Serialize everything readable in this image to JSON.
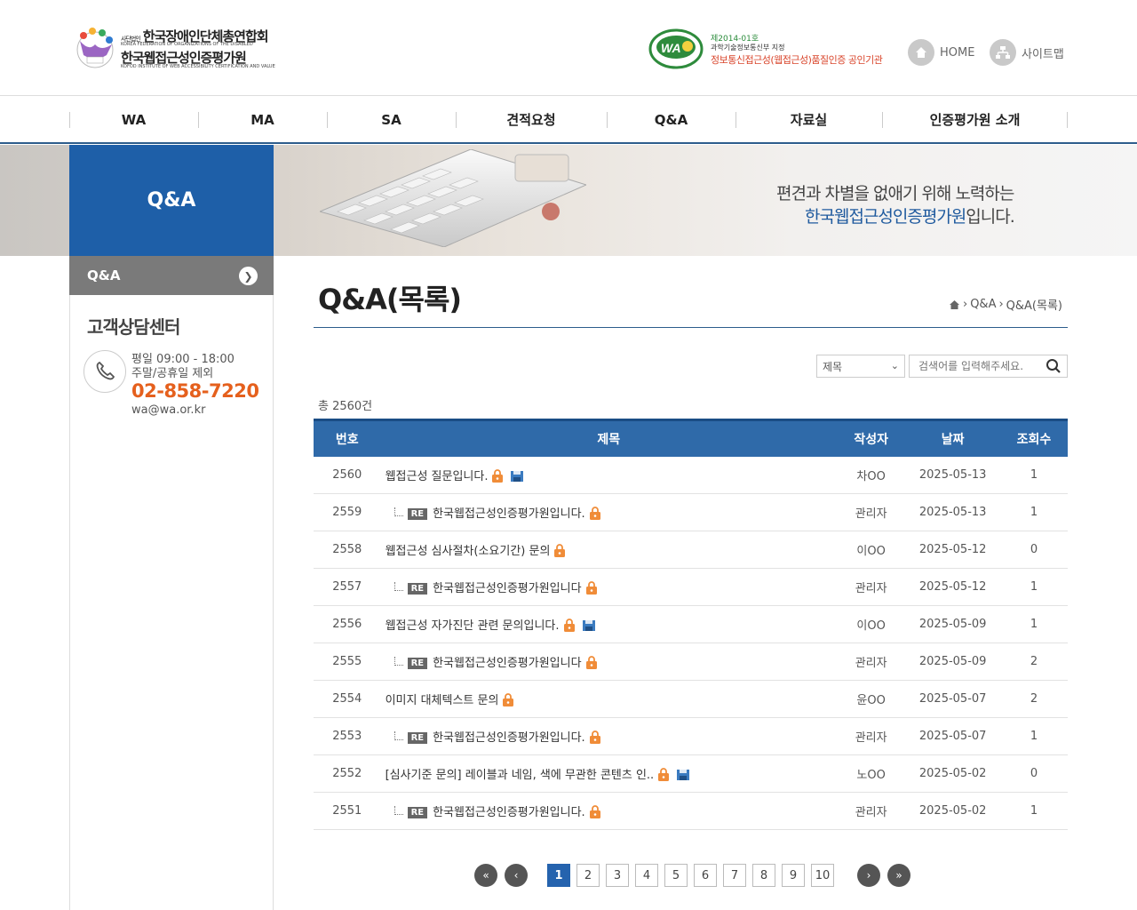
{
  "header": {
    "logo_top_small": "사단법인",
    "logo_top": "한국장애인단체총연합회",
    "logo_top_en": "KOREA FEDERATION OF ORGANIZATIONS OF THE DISABLED",
    "logo_main": "한국웹접근성인증평가원",
    "logo_main_en": "KOFOD INSTITUTE OF WEB ACCESSIBILITY CERTIFICATION AND VALUE",
    "cert_no": "제2014-01호",
    "cert_line1": "과학기술정보통신부 지정",
    "cert_line2": "정보통신접근성(웹접근성)품질인증 공인기관",
    "home_label": "HOME",
    "sitemap_label": "사이트맵"
  },
  "gnb": [
    {
      "label": "WA",
      "w": 145
    },
    {
      "label": "MA",
      "w": 145
    },
    {
      "label": "SA",
      "w": 145
    },
    {
      "label": "견적요청",
      "w": 170
    },
    {
      "label": "Q&A",
      "w": 145
    },
    {
      "label": "자료실",
      "w": 165
    },
    {
      "label": "인증평가원 소개",
      "w": 209
    }
  ],
  "banner": {
    "line1": "편견과 차별을 없애기 위해 노력하는",
    "line2_highlight": "한국웹접근성인증평가원",
    "line2_rest": "입니다."
  },
  "sidebar": {
    "title": "Q&A",
    "menu_item": "Q&A",
    "cs_title": "고객상담센터",
    "cs_hours": "평일 09:00 - 18:00",
    "cs_holiday": "주말/공휴일 제외",
    "cs_phone": "02-858-7220",
    "cs_email": "wa@wa.or.kr"
  },
  "content": {
    "title": "Q&A(목록)",
    "breadcrumb": [
      "Q&A",
      "Q&A(목록)"
    ],
    "search_select": "제목",
    "search_placeholder": "검색어를 입력해주세요.",
    "total": "총 2560건"
  },
  "table": {
    "headers": [
      "번호",
      "제목",
      "작성자",
      "날짜",
      "조회수"
    ],
    "rows": [
      {
        "no": "2560",
        "title": "웹접근성 질문입니다.",
        "reply": false,
        "file": true,
        "author": "차OO",
        "date": "2025-05-13",
        "views": "1"
      },
      {
        "no": "2559",
        "title": "한국웹접근성인증평가원입니다.",
        "reply": true,
        "file": false,
        "author": "관리자",
        "date": "2025-05-13",
        "views": "1"
      },
      {
        "no": "2558",
        "title": "웹접근성 심사절차(소요기간) 문의",
        "reply": false,
        "file": false,
        "author": "이OO",
        "date": "2025-05-12",
        "views": "0"
      },
      {
        "no": "2557",
        "title": "한국웹접근성인증평가원입니다",
        "reply": true,
        "file": false,
        "author": "관리자",
        "date": "2025-05-12",
        "views": "1"
      },
      {
        "no": "2556",
        "title": "웹접근성 자가진단 관련 문의입니다.",
        "reply": false,
        "file": true,
        "author": "이OO",
        "date": "2025-05-09",
        "views": "1"
      },
      {
        "no": "2555",
        "title": "한국웹접근성인증평가원입니다",
        "reply": true,
        "file": false,
        "author": "관리자",
        "date": "2025-05-09",
        "views": "2"
      },
      {
        "no": "2554",
        "title": "이미지 대체텍스트 문의",
        "reply": false,
        "file": false,
        "author": "윤OO",
        "date": "2025-05-07",
        "views": "2"
      },
      {
        "no": "2553",
        "title": "한국웹접근성인증평가원입니다.",
        "reply": true,
        "file": false,
        "author": "관리자",
        "date": "2025-05-07",
        "views": "1"
      },
      {
        "no": "2552",
        "title": "[심사기준 문의] 레이블과 네임, 색에 무관한 콘텐츠 인..",
        "reply": false,
        "file": true,
        "author": "노OO",
        "date": "2025-05-02",
        "views": "0"
      },
      {
        "no": "2551",
        "title": "한국웹접근성인증평가원입니다.",
        "reply": true,
        "file": false,
        "author": "관리자",
        "date": "2025-05-02",
        "views": "1"
      }
    ],
    "re_label": "RE"
  },
  "pagination": {
    "pages": [
      "1",
      "2",
      "3",
      "4",
      "5",
      "6",
      "7",
      "8",
      "9",
      "10"
    ],
    "current": "1",
    "first_icon": "double-chevron-left-icon",
    "prev_icon": "chevron-left-icon",
    "next_icon": "chevron-right-icon",
    "last_icon": "double-chevron-right-icon"
  },
  "colors": {
    "primary_blue": "#1e5fa8",
    "table_header": "#2f6aa9",
    "phone_orange": "#e5601d",
    "lock_orange": "#f08c38"
  }
}
